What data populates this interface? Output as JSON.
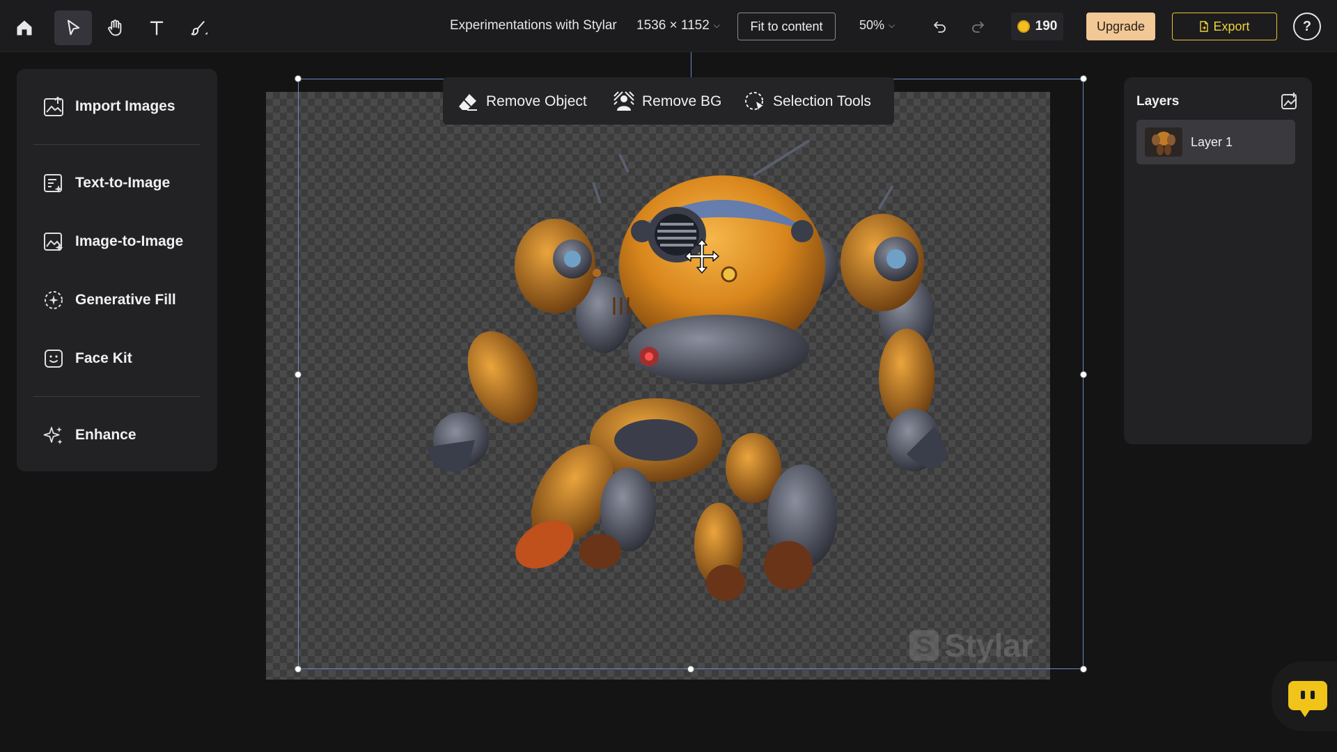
{
  "toolbar": {
    "icons": [
      "home-icon",
      "pointer-icon",
      "hand-icon",
      "text-icon",
      "brush-icon"
    ],
    "doc_title": "Experimentations with Stylar",
    "doc_size": "1536 × 1152",
    "fit_label": "Fit to content",
    "zoom": "50%",
    "credits": "190",
    "upgrade_label": "Upgrade",
    "export_label": "Export",
    "help_label": "?"
  },
  "sidebar": {
    "items": [
      {
        "label": "Import Images",
        "icon": "import-image-icon"
      },
      {
        "label": "Text-to-Image",
        "icon": "text-to-image-icon"
      },
      {
        "label": "Image-to-Image",
        "icon": "image-to-image-icon"
      },
      {
        "label": "Generative Fill",
        "icon": "generative-fill-icon"
      },
      {
        "label": "Face Kit",
        "icon": "face-icon"
      },
      {
        "label": "Enhance",
        "icon": "sparkle-icon"
      }
    ]
  },
  "floating_toolbar": {
    "remove_object": "Remove Object",
    "remove_bg": "Remove BG",
    "selection_tools": "Selection Tools"
  },
  "canvas": {
    "watermark": "Stylar"
  },
  "layers": {
    "title": "Layers",
    "items": [
      {
        "name": "Layer 1"
      }
    ]
  },
  "colors": {
    "accent_yellow": "#f0c419",
    "upgrade_bg": "#f1c896",
    "selection": "#6a8cc0"
  }
}
